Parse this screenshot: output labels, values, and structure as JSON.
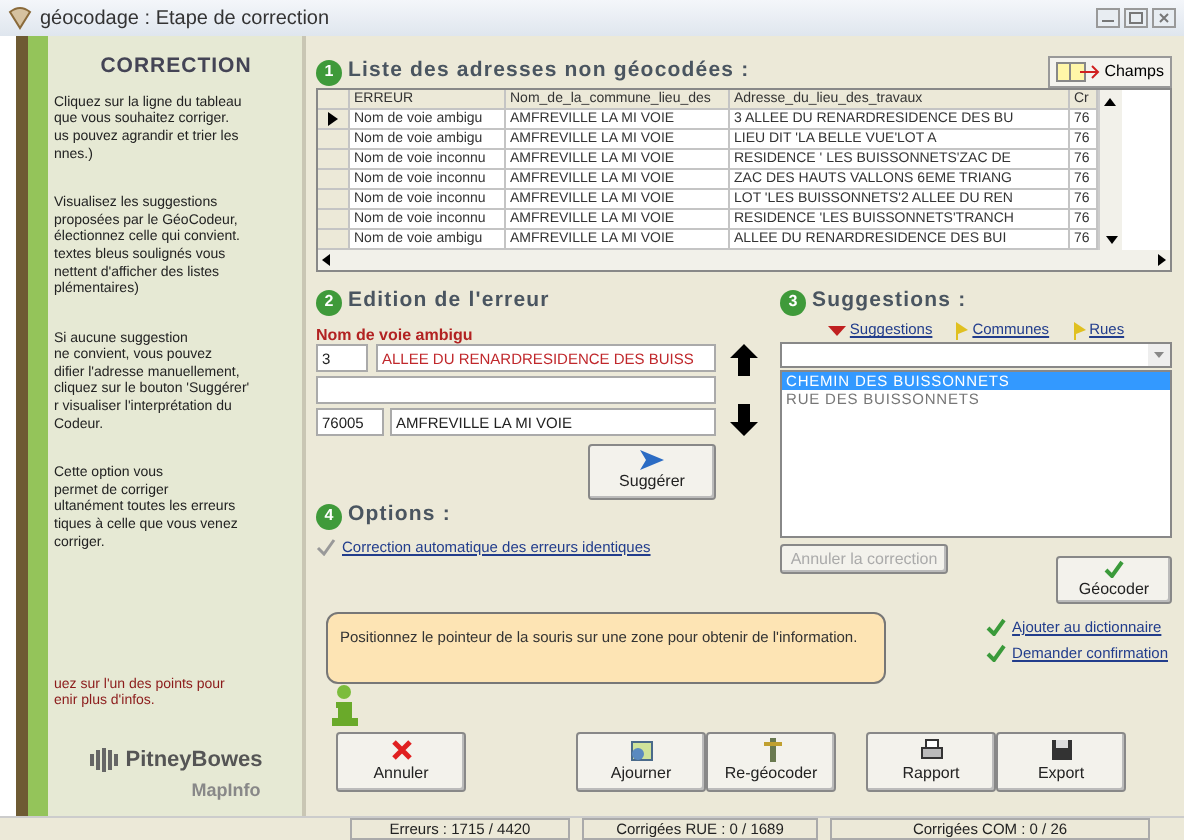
{
  "window": {
    "title": "géocodage : Etape de correction"
  },
  "sidebar": {
    "title": "CORRECTION",
    "paragraphs": [
      {
        "lines": [
          "Cliquez sur la ligne du tableau",
          "que vous souhaitez corriger.",
          "us pouvez agrandir et trier les",
          "nnes.)"
        ]
      },
      {
        "lines": [
          "Visualisez les suggestions",
          "proposées par le GéoCodeur,",
          "électionnez celle qui convient.",
          "textes bleus soulignés vous",
          "nettent d'afficher des listes",
          "plémentaires)"
        ]
      },
      {
        "lines": [
          "Si aucune suggestion",
          "ne convient, vous pouvez",
          "difier l'adresse manuellement,",
          "cliquez sur le bouton 'Suggérer'",
          "r visualiser l'interprétation du",
          "Codeur."
        ]
      },
      {
        "lines": [
          "Cette option vous",
          "permet de corriger",
          "ultanément toutes les erreurs",
          "tiques à celle que vous venez",
          "corriger."
        ]
      }
    ],
    "hint": {
      "lines": [
        "uez sur l'un des points pour",
        "enir plus d'infos."
      ]
    },
    "logo": {
      "brand": "PitneyBowes",
      "product": "MapInfo"
    }
  },
  "list_section": {
    "number": "1",
    "title": "Liste des adresses non géocodées :",
    "fields_button": "Champs",
    "table": {
      "columns": [
        "ERREUR",
        "Nom_de_la_commune_lieu_des",
        "Adresse_du_lieu_des_travaux",
        "Cr"
      ],
      "rows": [
        {
          "selected": true,
          "cells": [
            "Nom de voie ambigu",
            "AMFREVILLE LA MI VOIE",
            "3 ALLEE DU RENARDRESIDENCE DES BU",
            "76"
          ]
        },
        {
          "selected": false,
          "cells": [
            "Nom de voie ambigu",
            "AMFREVILLE LA MI VOIE",
            "LIEU DIT 'LA BELLE VUE'LOT A",
            "76"
          ]
        },
        {
          "selected": false,
          "cells": [
            "Nom de voie inconnu",
            "AMFREVILLE LA MI VOIE",
            "RESIDENCE ' LES BUISSONNETS'ZAC DE",
            "76"
          ]
        },
        {
          "selected": false,
          "cells": [
            "Nom de voie inconnu",
            "AMFREVILLE LA MI VOIE",
            "ZAC DES HAUTS VALLONS 6EME TRIANG",
            "76"
          ]
        },
        {
          "selected": false,
          "cells": [
            "Nom de voie inconnu",
            "AMFREVILLE LA MI VOIE",
            "LOT 'LES BUISSONNETS'2 ALLEE DU REN",
            "76"
          ]
        },
        {
          "selected": false,
          "cells": [
            "Nom de voie inconnu",
            "AMFREVILLE LA MI VOIE",
            "RESIDENCE 'LES BUISSONNETS'TRANCH",
            "76"
          ]
        },
        {
          "selected": false,
          "cells": [
            "Nom de voie ambigu",
            "AMFREVILLE LA MI VOIE",
            "ALLEE DU RENARDRESIDENCE DES BUI",
            "76"
          ]
        }
      ]
    }
  },
  "edit_section": {
    "number": "2",
    "title": "Edition de l'erreur",
    "error_label": "Nom de voie ambigu",
    "number_field": "3",
    "street_field": "ALLEE DU RENARDRESIDENCE DES BUISS",
    "postcode_field": "76005",
    "commune_field": "AMFREVILLE LA MI VOIE",
    "suggest_button": "Suggérer"
  },
  "suggestions_section": {
    "number": "3",
    "title": "Suggestions :",
    "filters": [
      {
        "kind": "triangle",
        "label": "Suggestions"
      },
      {
        "kind": "flag",
        "label": "Communes"
      },
      {
        "kind": "flag",
        "label": "Rues"
      }
    ],
    "items": [
      {
        "text": "CHEMIN DES BUISSONNETS",
        "selected": true
      },
      {
        "text": "RUE DES BUISSONNETS",
        "selected": false
      }
    ],
    "undo_button": {
      "label": "Annuler la correction",
      "disabled": true
    },
    "geocode_button": "Géocoder",
    "links": [
      {
        "label": "Ajouter au dictionnaire",
        "checked": true
      },
      {
        "label": "Demander confirmation",
        "checked": true
      }
    ]
  },
  "options_section": {
    "number": "4",
    "title": "Options :",
    "options": [
      {
        "label": "Correction automatique des erreurs identiques",
        "checked": true
      }
    ]
  },
  "info_bubble": "Positionnez le pointeur de la souris sur une zone pour obtenir de l'information.",
  "buttons": [
    {
      "kind": "cross",
      "label": "Annuler"
    },
    {
      "kind": "calendar",
      "label": "Ajourner"
    },
    {
      "kind": "tool",
      "label": "Re-géocoder"
    },
    {
      "kind": "printer",
      "label": "Rapport"
    },
    {
      "kind": "floppy",
      "label": "Export"
    }
  ],
  "status_bar": [
    "Erreurs : 1715 / 4420",
    "Corrigées RUE : 0 / 1689",
    "Corrigées COM : 0 / 26"
  ]
}
